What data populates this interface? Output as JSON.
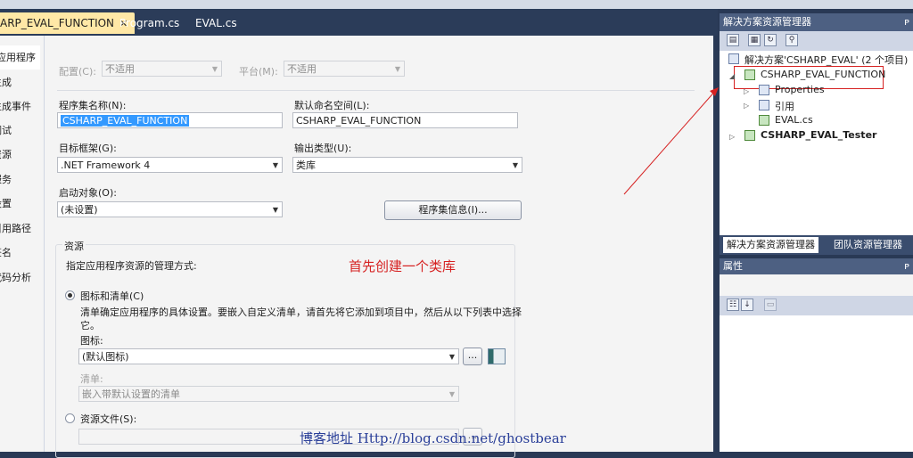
{
  "tabs": [
    {
      "label": "ARP_EVAL_FUNCTION",
      "close": "✕"
    },
    {
      "label": "Program.cs"
    },
    {
      "label": "EVAL.cs"
    }
  ],
  "leftnav": [
    "应用程序",
    "生成",
    "生成事件",
    "调试",
    "资源",
    "服务",
    "设置",
    "引用路径",
    "签名",
    "代码分析"
  ],
  "config": {
    "config_label": "配置(C):",
    "config_value": "不适用",
    "platform_label": "平台(M):",
    "platform_value": "不适用"
  },
  "form": {
    "assembly_label": "程序集名称(N):",
    "assembly_value": "CSHARP_EVAL_FUNCTION",
    "namespace_label": "默认命名空间(L):",
    "namespace_value": "CSHARP_EVAL_FUNCTION",
    "framework_label": "目标框架(G):",
    "framework_value": ".NET Framework 4",
    "output_label": "输出类型(U):",
    "output_value": "类库",
    "startup_label": "启动对象(O):",
    "startup_value": "(未设置)",
    "assembly_info_button": "程序集信息(I)..."
  },
  "resources": {
    "title": "资源",
    "desc": "指定应用程序资源的管理方式:",
    "icon_manifest_label": "图标和清单(C)",
    "icon_manifest_desc": "清单确定应用程序的具体设置。要嵌入自定义清单，请首先将它添加到项目中，然后从以下列表中选择",
    "icon_manifest_desc2": "它。",
    "icon_label": "图标:",
    "icon_value": "(默认图标)",
    "browse_button": "...",
    "manifest_label": "清单:",
    "manifest_value": "嵌入带默认设置的清单",
    "resource_file_label": "资源文件(S):"
  },
  "annotation": "首先创建一个类库",
  "watermark": "博客地址 Http://blog.csdn.net/ghostbear",
  "solution_explorer": {
    "title": "解决方案资源管理器",
    "solution": "解决方案'CSHARP_EVAL' (2 个项目)",
    "project1": "CSHARP_EVAL_FUNCTION",
    "properties": "Properties",
    "references": "引用",
    "file": "EVAL.cs",
    "project2": "CSHARP_EVAL_Tester",
    "pin": "ᴘ"
  },
  "panel_tabs": [
    "解决方案资源管理器",
    "团队资源管理器"
  ],
  "properties_pane": {
    "title": "属性"
  },
  "colors": {
    "accent": "#3399ff",
    "annotation": "#d62222",
    "watermark": "#2a3f99",
    "active_tab": "#ffe8a6"
  }
}
